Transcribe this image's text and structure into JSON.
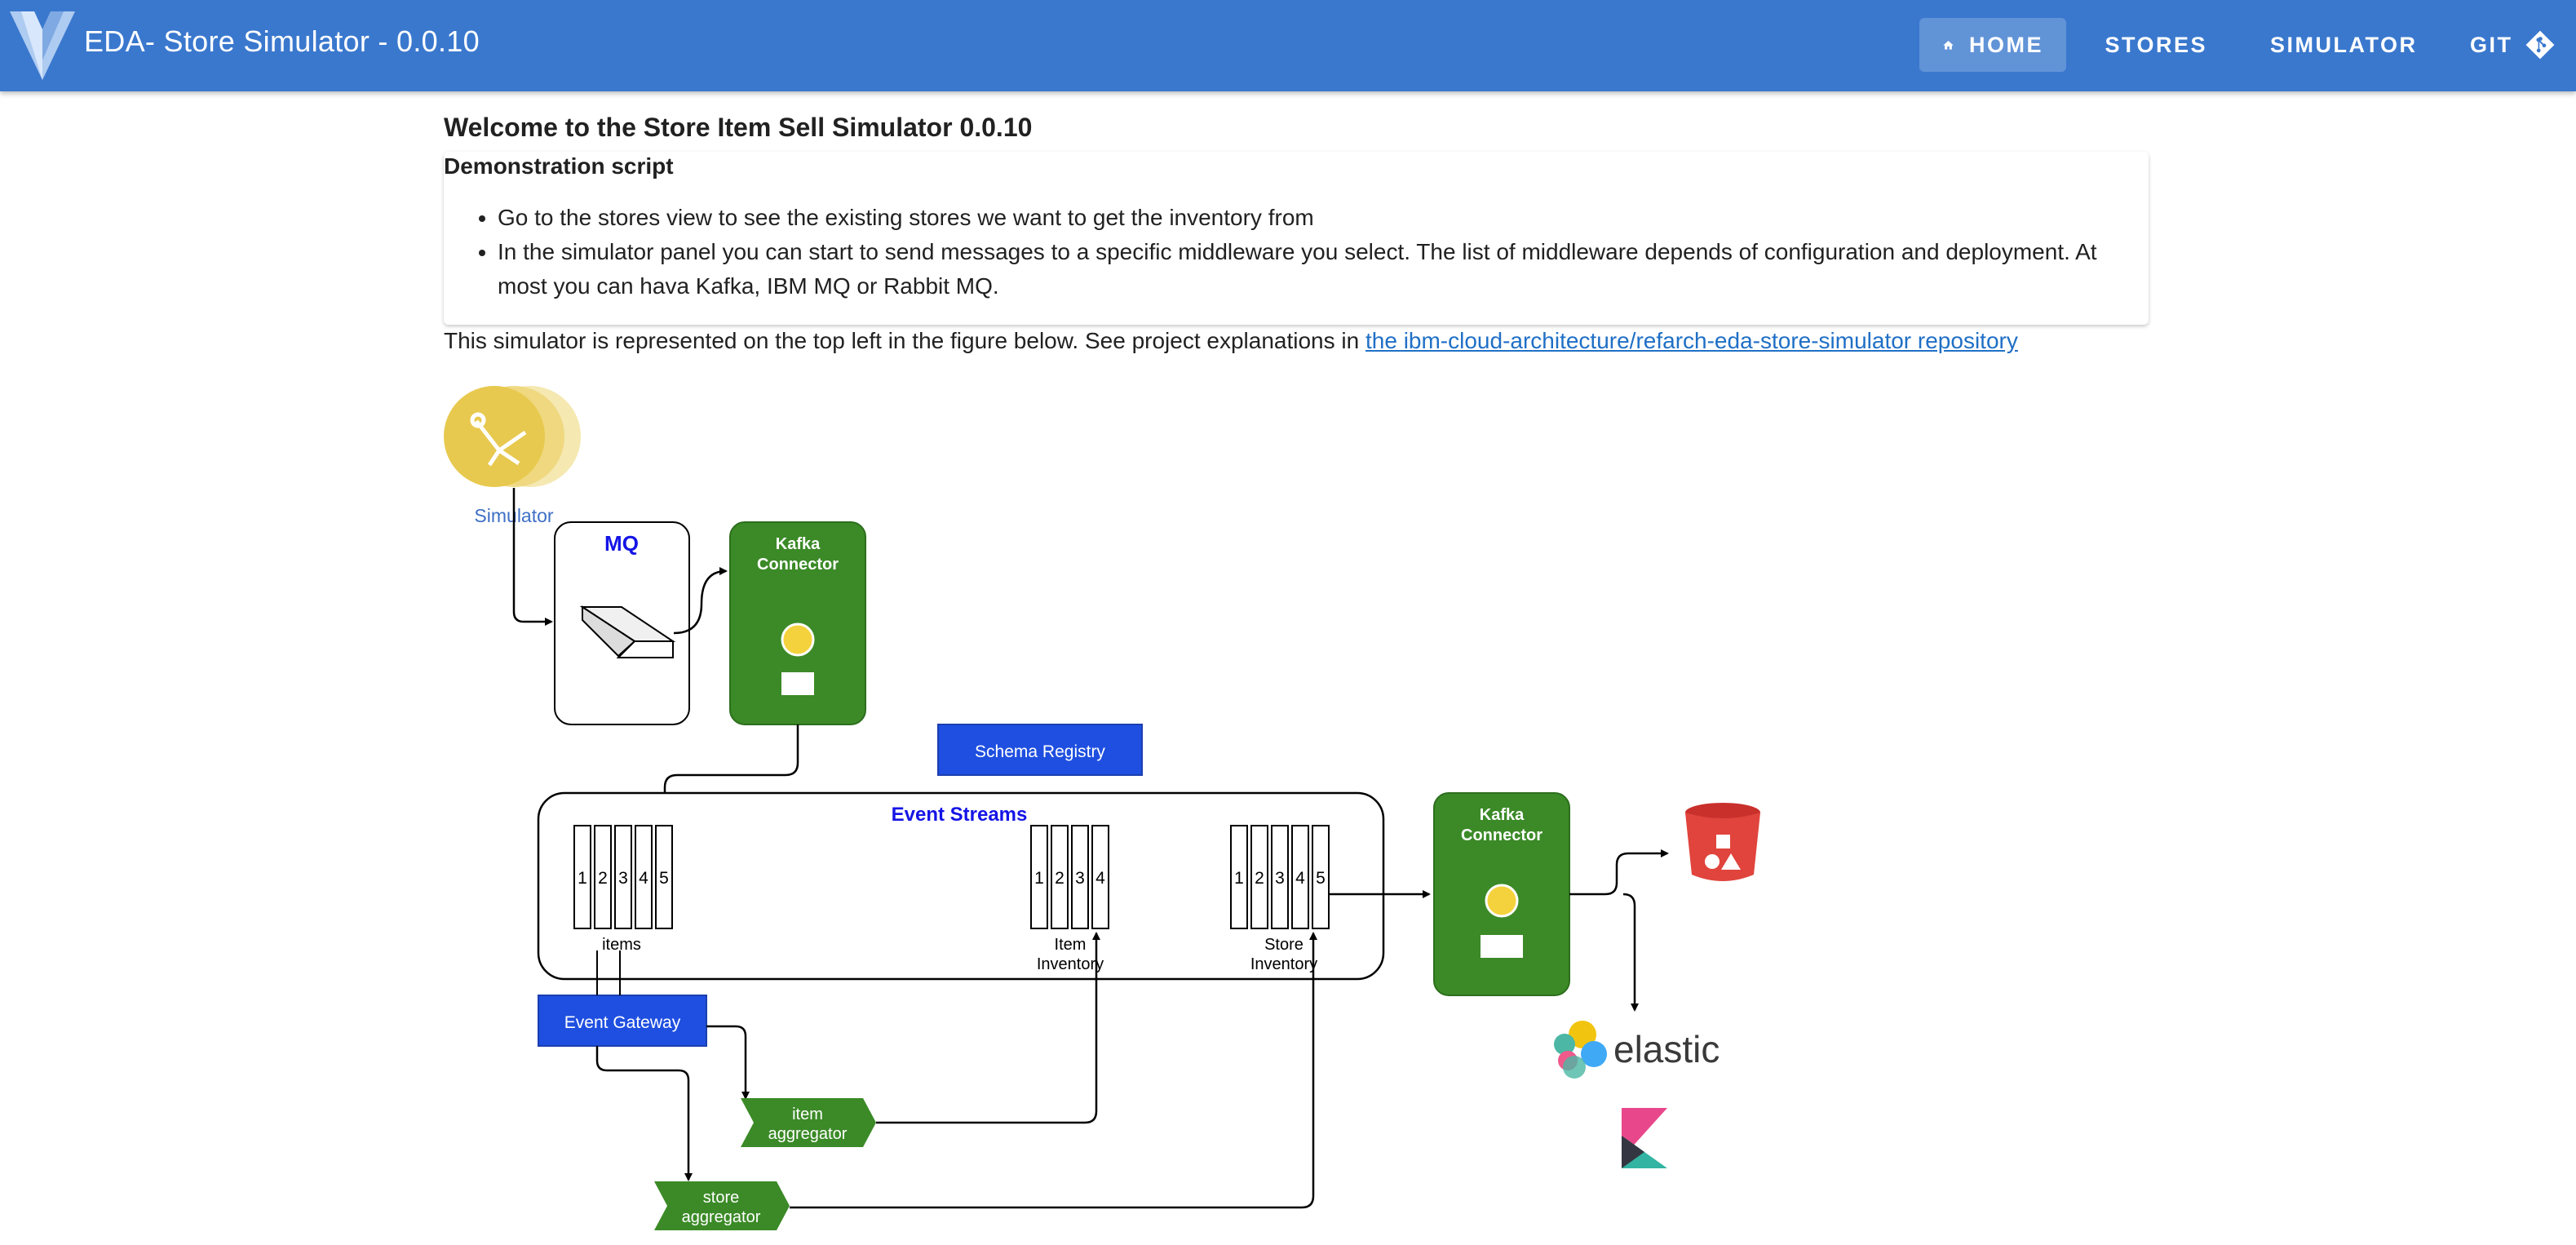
{
  "app": {
    "title": "EDA- Store Simulator - 0.0.10"
  },
  "nav": {
    "home": "HOME",
    "stores": "STORES",
    "simulator": "SIMULATOR",
    "git": "GIT"
  },
  "page": {
    "title": "Welcome to the Store Item Sell Simulator 0.0.10",
    "demo_heading": "Demonstration script",
    "bullets": [
      "Go to the stores view to see the existing stores we want to get the inventory from",
      "In the simulator panel you can start to send messages to a specific middleware you select. The list of middleware depends of configuration and deployment. At most you can hava Kafka, IBM MQ or Rabbit MQ."
    ],
    "explanation_prefix": "This simulator is represented on the top left in the figure below. See project explanations in ",
    "explanation_link": "the ibm-cloud-architecture/refarch-eda-store-simulator repository"
  },
  "diagram": {
    "simulator_label": "Simulator",
    "mq_label": "MQ",
    "kafka_connector_label_1": "Kafka",
    "kafka_connector_label_2": "Connector",
    "schema_registry": "Schema Registry",
    "event_streams": "Event Streams",
    "items_label": "items",
    "item_inventory_1": "Item",
    "item_inventory_2": "Inventory",
    "store_inventory_1": "Store",
    "store_inventory_2": "Inventory",
    "event_gateway": "Event Gateway",
    "item_aggregator_1": "item",
    "item_aggregator_2": "aggregator",
    "store_aggregator_1": "store",
    "store_aggregator_2": "aggregator",
    "elastic": "elastic",
    "partitions_5": [
      "1",
      "2",
      "3",
      "4",
      "5"
    ],
    "partitions_4": [
      "1",
      "2",
      "3",
      "4"
    ]
  },
  "colors": {
    "appbar": "#3a78ce",
    "kafka_green": "#3b8a27",
    "schema_blue": "#1f4fe0",
    "event_streams_text": "#1414e6",
    "link": "#1f6fc6"
  },
  "icons": {
    "logo": "vuetify-logo",
    "home": "home-icon",
    "stores": "storefront-icon",
    "simulator": "table-icon",
    "git": "git-icon"
  }
}
